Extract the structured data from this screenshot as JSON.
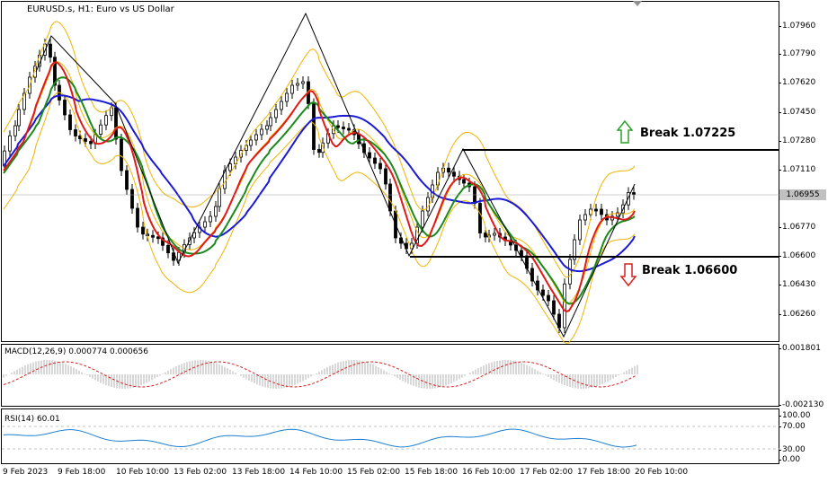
{
  "header": {
    "title": "EURUSD.s, H1:  Euro vs US Dollar"
  },
  "icons": [
    "chart-window-icon",
    "chart-properties-icon",
    "scroll-marker-icon"
  ],
  "colors": {
    "bollinger": "#f0b400",
    "ma_blue": "#1a1ad6",
    "ma_green": "#1a8a1a",
    "ma_red": "#e01a1a",
    "candle": "#000000",
    "arrow_up": "#2aa32a",
    "arrow_down": "#d62020",
    "macd_signal": "#d62020",
    "macd_hist": "#b0b0b0",
    "rsi_line": "#1e7fd0"
  },
  "price_axis": {
    "ticks": [
      "1.07960",
      "1.07790",
      "1.07620",
      "1.07450",
      "1.07280",
      "1.07110",
      "1.06955",
      "1.06770",
      "1.06600",
      "1.06430",
      "1.06260"
    ],
    "current_price": "1.06955"
  },
  "annotations": {
    "break_up": "Break 1.07225",
    "break_down": "Break 1.06600"
  },
  "macd": {
    "label": "MACD(12,26,9) 0.000774 0.000656",
    "axis_top": "0.001801",
    "axis_bottom": "-0.002130"
  },
  "rsi": {
    "label": "RSI(14) 60.01",
    "axis": [
      "100.00",
      "70.00",
      "30.00",
      "0.00"
    ]
  },
  "time_axis": {
    "ticks": [
      "9 Feb 2023",
      "9 Feb 18:00",
      "10 Feb 10:00",
      "13 Feb 02:00",
      "13 Feb 18:00",
      "14 Feb 10:00",
      "15 Feb 02:00",
      "15 Feb 18:00",
      "16 Feb 10:00",
      "17 Feb 02:00",
      "17 Feb 18:00",
      "20 Feb 10:00"
    ]
  }
}
